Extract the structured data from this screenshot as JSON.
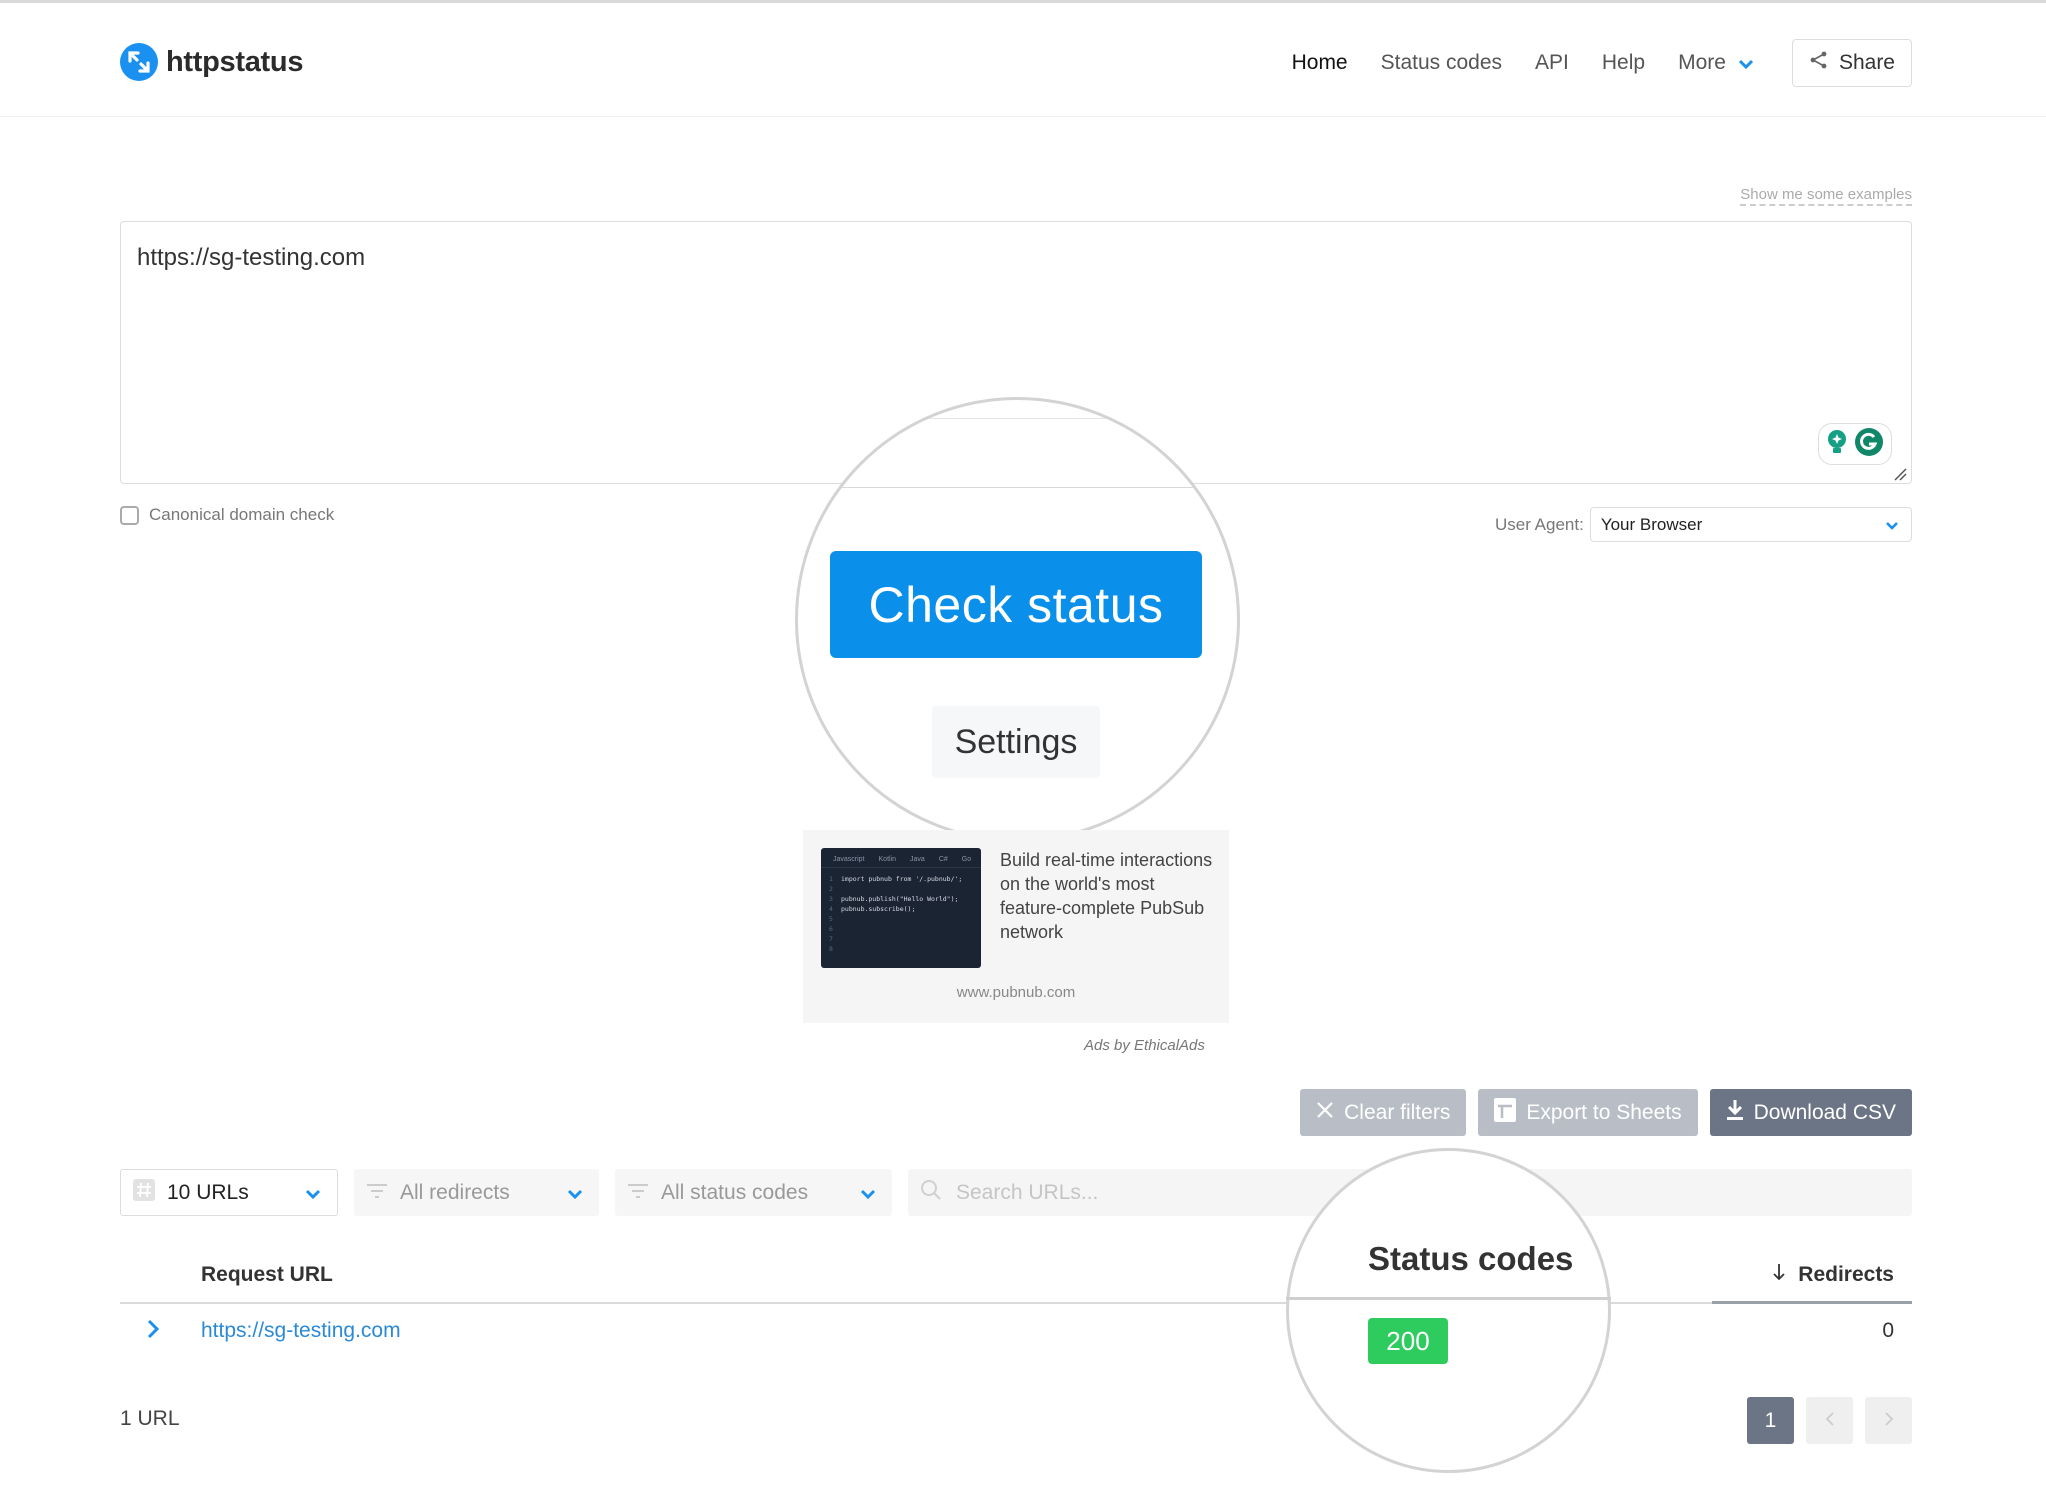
{
  "brand": {
    "name": "httpstatus",
    "accent": "#1a91f0"
  },
  "nav": {
    "items": [
      {
        "label": "Home",
        "active": true
      },
      {
        "label": "Status codes"
      },
      {
        "label": "API"
      },
      {
        "label": "Help"
      }
    ],
    "more_label": "More",
    "share_label": "Share"
  },
  "input": {
    "examples_link": "Show me some examples",
    "urls_value": "https://sg-testing.com",
    "canonical_label": "Canonical domain check",
    "canonical_checked": false,
    "user_agent_label": "User Agent:",
    "user_agent_value": "Your Browser"
  },
  "buttons": {
    "check_status": "Check status",
    "settings": "Settings"
  },
  "ad": {
    "text": "Build real-time interactions on the world's most feature-complete PubSub network",
    "domain": "www.pubnub.com",
    "attribution": "Ads by EthicalAds",
    "code_tabs": [
      "Javascript",
      "Kotlin",
      "Java",
      "C#",
      "Go"
    ],
    "code_lines": [
      "import pubnub from '/.pubnub/';",
      "",
      "pubnub.publish(\"Hello World\");",
      "pubnub.subscribe();",
      "",
      "",
      "",
      ""
    ]
  },
  "actions": {
    "clear_filters": "Clear filters",
    "export_sheets": "Export to Sheets",
    "download_csv": "Download CSV"
  },
  "filters": {
    "urls_per_page": "10 URLs",
    "redirects": "All redirects",
    "status_codes": "All status codes",
    "search_placeholder": "Search URLs..."
  },
  "table": {
    "columns": {
      "request_url": "Request URL",
      "status_codes": "Status codes",
      "redirects": "Redirects"
    },
    "rows": [
      {
        "url": "https://sg-testing.com",
        "status": "200",
        "status_color": "#2ecc5e",
        "redirects": "0"
      }
    ]
  },
  "footer": {
    "count": "1 URL",
    "current_page": "1"
  }
}
